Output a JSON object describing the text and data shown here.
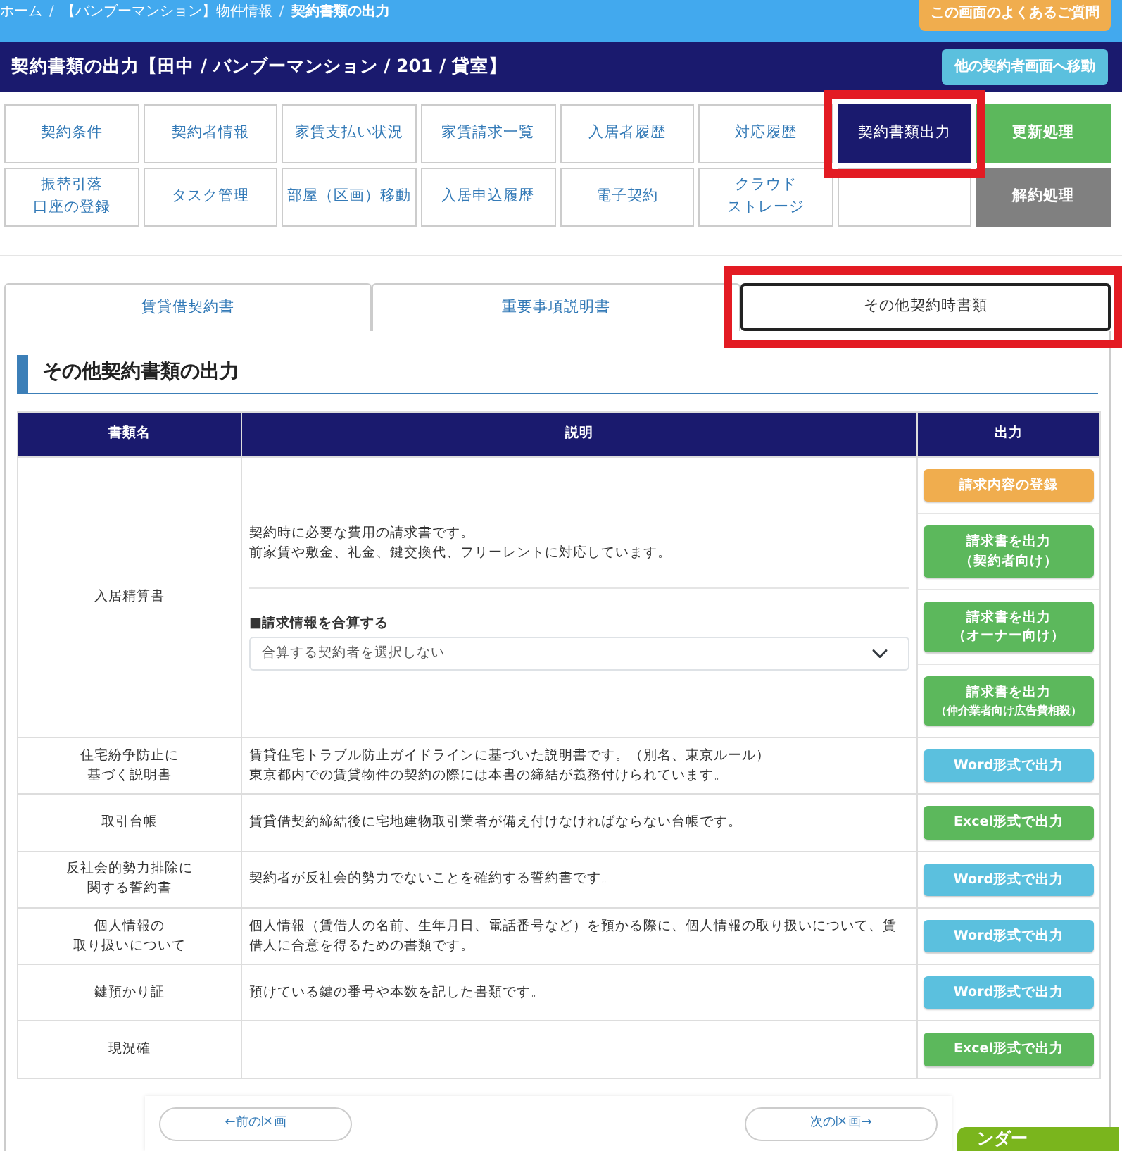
{
  "breadcrumb": [
    {
      "kind": "link",
      "text": "ホーム"
    },
    {
      "kind": "separator",
      "text": "/"
    },
    {
      "kind": "link",
      "text": "【バンブーマンション】物件情報"
    },
    {
      "kind": "separator",
      "text": "/"
    },
    {
      "kind": "current",
      "text": "契約書類の出力"
    }
  ],
  "faq_button": "この画面のよくあるご質問",
  "header": {
    "title": "契約書類の出力【田中 / バンブーマンション / 201 / 貸室】",
    "switch_button": "他の契約者画面へ移動"
  },
  "menu": [
    {
      "lines": [
        "契約条件"
      ],
      "kind": "normal",
      "selected": false
    },
    {
      "lines": [
        "契約者情報"
      ],
      "kind": "normal",
      "selected": false
    },
    {
      "lines": [
        "家賃支払い状況"
      ],
      "kind": "normal",
      "selected": false
    },
    {
      "lines": [
        "家賃請求一覧"
      ],
      "kind": "normal",
      "selected": false
    },
    {
      "lines": [
        "入居者履歴"
      ],
      "kind": "normal",
      "selected": false
    },
    {
      "lines": [
        "対応履歴"
      ],
      "kind": "normal",
      "selected": false
    },
    {
      "lines": [
        "契約書類出力"
      ],
      "kind": "normal",
      "selected": true,
      "highlighted": true
    },
    {
      "lines": [
        "更新処理"
      ],
      "kind": "green",
      "selected": false
    },
    {
      "lines": [
        "振替引落",
        "口座の登録"
      ],
      "kind": "normal",
      "selected": false
    },
    {
      "lines": [
        "タスク管理"
      ],
      "kind": "normal",
      "selected": false
    },
    {
      "lines": [
        "部屋（区画）移動"
      ],
      "kind": "normal",
      "selected": false
    },
    {
      "lines": [
        "入居申込履歴"
      ],
      "kind": "normal",
      "selected": false
    },
    {
      "lines": [
        "電子契約"
      ],
      "kind": "normal",
      "selected": false
    },
    {
      "lines": [
        "クラウド",
        "ストレージ"
      ],
      "kind": "normal",
      "selected": false
    },
    {
      "kind": "blank",
      "selected": false
    },
    {
      "lines": [
        "解約処理"
      ],
      "kind": "gray",
      "selected": false
    }
  ],
  "tabs": [
    {
      "label": "賃貸借契約書",
      "selected": false
    },
    {
      "label": "重要事項説明書",
      "selected": false
    },
    {
      "label": "その他契約時書類",
      "selected": true,
      "highlighted": true
    }
  ],
  "section_title": "その他契約書類の出力",
  "table": {
    "columns": [
      "書類名",
      "説明",
      "出力"
    ],
    "rows": [
      {
        "name": [
          "入居精算書"
        ],
        "description": [
          "契約時に必要な費用の請求書です。",
          "前家賃や敷金、礼金、鍵交換代、フリーレントに対応しています。"
        ],
        "combine_label": "■請求情報を合算する",
        "combine_select": "合算する契約者を選択しない",
        "buttons": [
          {
            "label": "請求内容の登録",
            "kind": "orange"
          },
          {
            "label": "請求書を出力",
            "sublabel": "（契約者向け）",
            "kind": "green"
          },
          {
            "label": "請求書を出力",
            "sublabel": "（オーナー向け）",
            "kind": "green"
          },
          {
            "label": "請求書を出力",
            "sublabel": "（仲介業者向け広告費相殺）",
            "kind": "green"
          }
        ]
      },
      {
        "name": [
          "住宅紛争防止に",
          "基づく説明書"
        ],
        "description": [
          "賃貸住宅トラブル防止ガイドラインに基づいた説明書です。（別名、東京ルール）",
          "東京都内での賃貸物件の契約の際には本書の締結が義務付けられています。"
        ],
        "buttons": [
          {
            "label": "Word形式で出力",
            "kind": "info"
          }
        ]
      },
      {
        "name": [
          "取引台帳"
        ],
        "description": [
          "賃貸借契約締結後に宅地建物取引業者が備え付けなければならない台帳です。"
        ],
        "buttons": [
          {
            "label": "Excel形式で出力",
            "kind": "green"
          }
        ]
      },
      {
        "name": [
          "反社会的勢力排除に",
          "関する誓約書"
        ],
        "description": [
          "契約者が反社会的勢力でないことを確約する誓約書です。"
        ],
        "buttons": [
          {
            "label": "Word形式で出力",
            "kind": "info"
          }
        ]
      },
      {
        "name": [
          "個人情報の",
          "取り扱いについて"
        ],
        "description": [
          "個人情報（賃借人の名前、生年月日、電話番号など）を預かる際に、個人情報の取り扱いについて、賃借人に合意を得るための書類です。"
        ],
        "buttons": [
          {
            "label": "Word形式で出力",
            "kind": "info"
          }
        ]
      },
      {
        "name": [
          "鍵預かり証"
        ],
        "description": [
          "預けている鍵の番号や本数を記した書類です。"
        ],
        "buttons": [
          {
            "label": "Word形式で出力",
            "kind": "info"
          }
        ]
      },
      {
        "name": [
          "現況確"
        ],
        "buttons": [
          {
            "label": "Excel形式で出力",
            "kind": "green"
          }
        ]
      }
    ]
  },
  "pager": {
    "prev": "←前の区画",
    "next": "次の区画→"
  },
  "calendar_tab": "ンダー"
}
